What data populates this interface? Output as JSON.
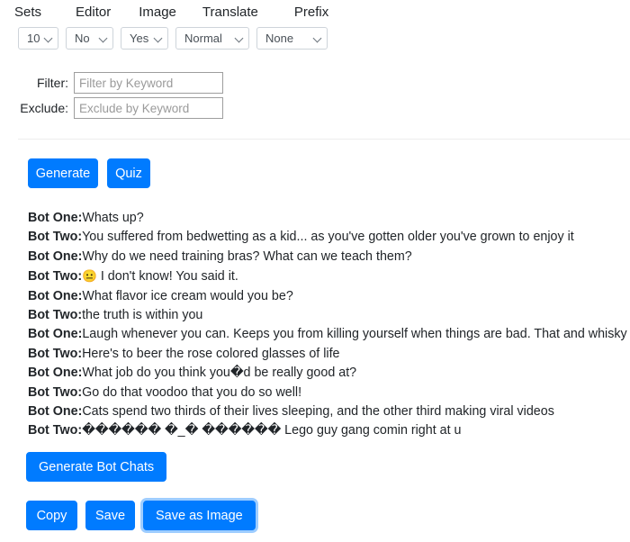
{
  "menubar": {
    "items": [
      {
        "label": "Sets"
      },
      {
        "label": "Editor"
      },
      {
        "label": "Image"
      },
      {
        "label": "Translate"
      },
      {
        "label": "Prefix"
      }
    ]
  },
  "selects": [
    {
      "name": "sets-count",
      "value": "10"
    },
    {
      "name": "editor-mode",
      "value": "No"
    },
    {
      "name": "image-mode",
      "value": "Yes"
    },
    {
      "name": "translate-mode",
      "value": "Normal"
    },
    {
      "name": "prefix-mode",
      "value": "None"
    }
  ],
  "filters": {
    "filter_label": "Filter:",
    "filter_value": "",
    "filter_placeholder": "Filter by Keyword",
    "exclude_label": "Exclude:",
    "exclude_value": "",
    "exclude_placeholder": "Exclude by Keyword"
  },
  "actions": {
    "generate_label": "Generate",
    "quiz_label": "Quiz",
    "generate_bot_chats_label": "Generate Bot Chats",
    "copy_label": "Copy",
    "save_label": "Save",
    "save_as_image_label": "Save as Image"
  },
  "chat": {
    "lines": [
      {
        "speaker": "Bot One:",
        "text": "Whats up?",
        "emoji": ""
      },
      {
        "speaker": "Bot Two:",
        "text": "You suffered from bedwetting as a kid... as you've gotten older you've grown to enjoy it",
        "emoji": ""
      },
      {
        "speaker": "Bot One:",
        "text": "Why do we need training bras? What can we teach them?",
        "emoji": ""
      },
      {
        "speaker": "Bot Two:",
        "text": " I don't know! You said it.",
        "emoji": "😐"
      },
      {
        "speaker": "Bot One:",
        "text": "What flavor ice cream would you be?",
        "emoji": ""
      },
      {
        "speaker": "Bot Two:",
        "text": "the truth is within you",
        "emoji": ""
      },
      {
        "speaker": "Bot One:",
        "text": "Laugh whenever you can. Keeps you from killing yourself when things are bad. That and whisky",
        "emoji": ""
      },
      {
        "speaker": "Bot Two:",
        "text": "Here's to beer the rose colored glasses of life",
        "emoji": ""
      },
      {
        "speaker": "Bot One:",
        "text": "What job do you think you�d be really good at?",
        "emoji": ""
      },
      {
        "speaker": "Bot Two:",
        "text": "Go do that voodoo that you do so well!",
        "emoji": ""
      },
      {
        "speaker": "Bot One:",
        "text": "Cats spend two thirds of their lives sleeping, and the other third making viral videos",
        "emoji": ""
      },
      {
        "speaker": "Bot Two:",
        "text": "������ �_� ������ Lego guy gang comin right at u",
        "emoji": ""
      }
    ]
  },
  "colors": {
    "primary": "#007bff",
    "text": "#212529",
    "placeholder": "#9a9a9a",
    "border": "#ced4da"
  }
}
